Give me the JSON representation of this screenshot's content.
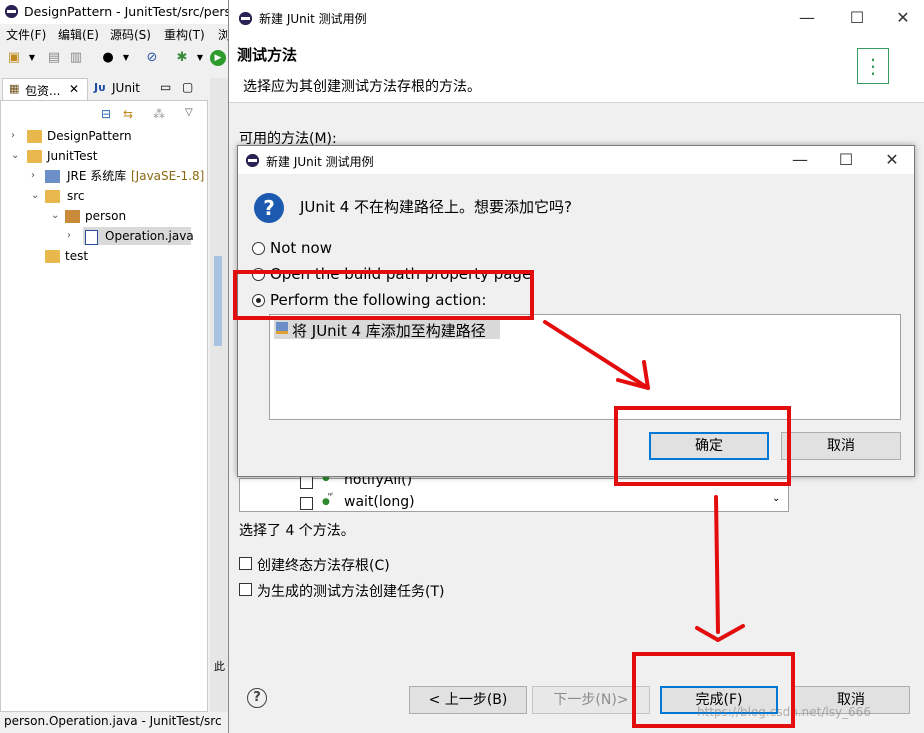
{
  "eclipse": {
    "title": "DesignPattern - JunitTest/src/perso",
    "menu": [
      "文件(F)",
      "编辑(E)",
      "源码(S)",
      "重构(T)",
      "浏"
    ],
    "tabs": {
      "package_explorer": "包资...",
      "junit": "JUnit"
    },
    "tree": {
      "design_pattern": "DesignPattern",
      "junit_test": "JunitTest",
      "jre": "JRE 系统库",
      "jre_version": "[JavaSE-1.8]",
      "src": "src",
      "person": "person",
      "operation": "Operation.java",
      "test": "test"
    },
    "status": "person.Operation.java - JunitTest/src",
    "side_label": "此"
  },
  "wizard": {
    "title": "新建 JUnit 测试用例",
    "banner_title": "测试方法",
    "banner_subtitle": "选择应为其创建测试方法存根的方法。",
    "available_methods_label": "可用的方法(M):",
    "methods": [
      {
        "name": "notifyAll()",
        "checked": false
      },
      {
        "name": "wait(long)",
        "checked": false
      }
    ],
    "selected_count": "选择了 4 个方法。",
    "create_final_stubs": "创建终态方法存根(C)",
    "create_tasks": "为生成的测试方法创建任务(T)",
    "buttons": {
      "back": "< 上一步(B)",
      "next": "下一步(N)>",
      "finish": "完成(F)",
      "cancel": "取消"
    },
    "watermark": "https://blog.csdn.net/lsy_666"
  },
  "popup": {
    "title": "新建 JUnit 测试用例",
    "question": "JUnit 4 不在构建路径上。想要添加它吗?",
    "options": [
      "Not now",
      "Open the build path property page",
      "Perform the following action:"
    ],
    "selected_option": 2,
    "action_item": "将 JUnit 4 库添加至构建路径",
    "buttons": {
      "ok": "确定",
      "cancel": "取消"
    }
  },
  "colors": {
    "annotation": "#e30d0d",
    "focus": "#0078d7",
    "selection": "#cce8ff"
  }
}
